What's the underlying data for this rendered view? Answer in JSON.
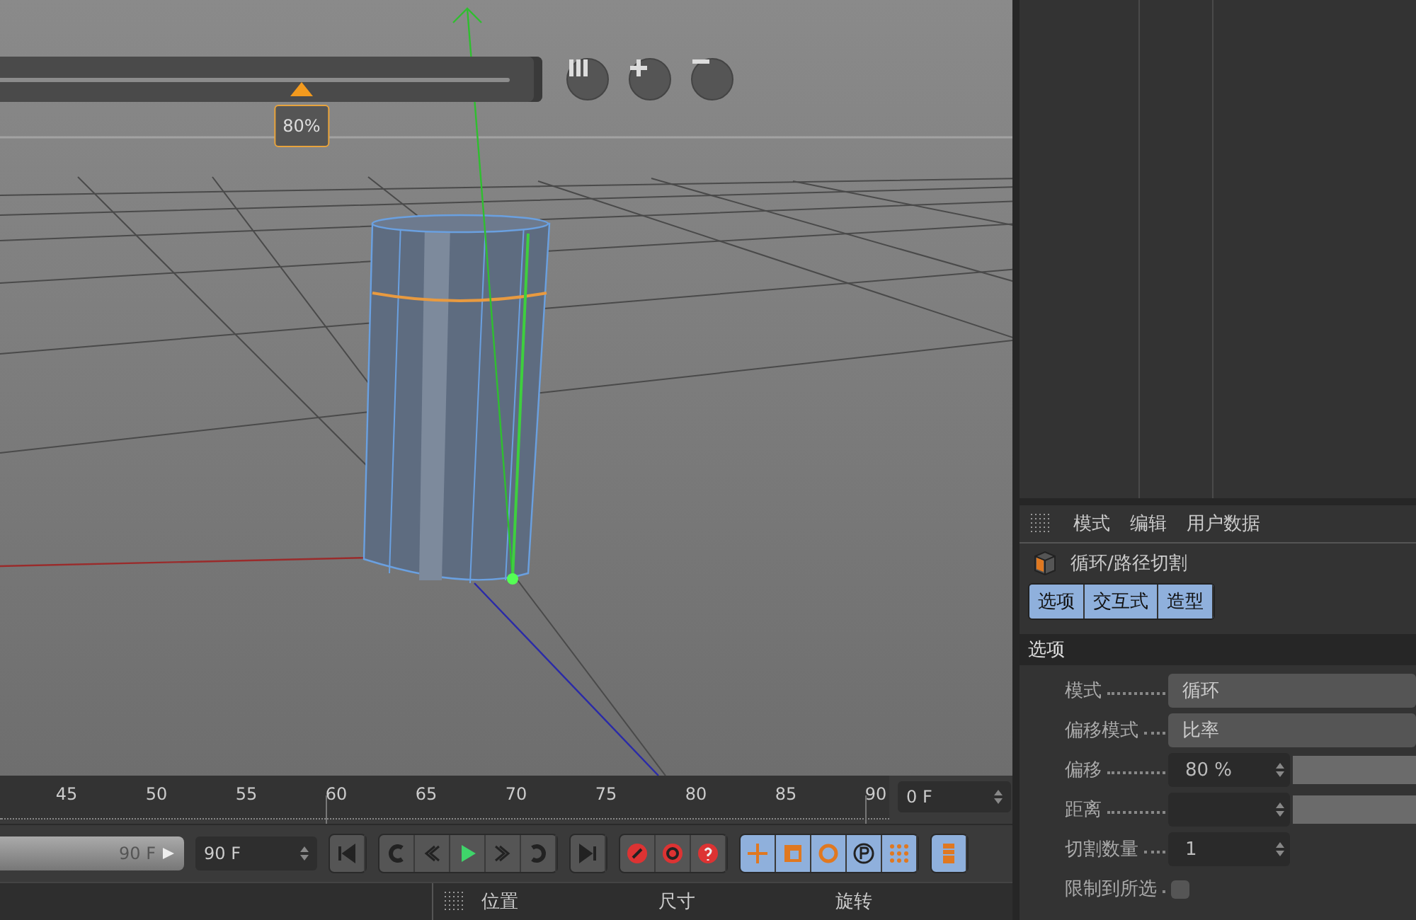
{
  "viewport": {
    "zoom_slider": {
      "level": 0.8,
      "reading": "80%"
    }
  },
  "timeline": {
    "ruler_labels": [
      "45",
      "50",
      "55",
      "60",
      "65",
      "70",
      "75",
      "80",
      "85",
      "90"
    ],
    "current_frame": "0 F",
    "end_slider": {
      "value": "90 F",
      "level": 1
    },
    "end_field": "90 F"
  },
  "coordinates": {
    "columns": [
      "位置",
      "尺寸",
      "旋转"
    ]
  },
  "attributes": {
    "menu": [
      "模式",
      "编辑",
      "用户数据"
    ],
    "title": "循环/路径切割",
    "tabs": [
      {
        "label": "选项",
        "selected": true
      },
      {
        "label": "交互式",
        "selected": true
      },
      {
        "label": "造型",
        "selected": true
      }
    ],
    "section": "选项",
    "rows": [
      {
        "kind": "dropdown",
        "label": "模式",
        "value": "循环"
      },
      {
        "kind": "dropdown",
        "label": "偏移模式",
        "value": "比率"
      },
      {
        "kind": "slider",
        "label": "偏移",
        "value": "80 %"
      },
      {
        "kind": "slider",
        "label": "距离"
      },
      {
        "kind": "number",
        "label": "切割数量",
        "value": "1"
      },
      {
        "kind": "checkbox",
        "label": "限制到所选",
        "checked": false
      }
    ]
  }
}
